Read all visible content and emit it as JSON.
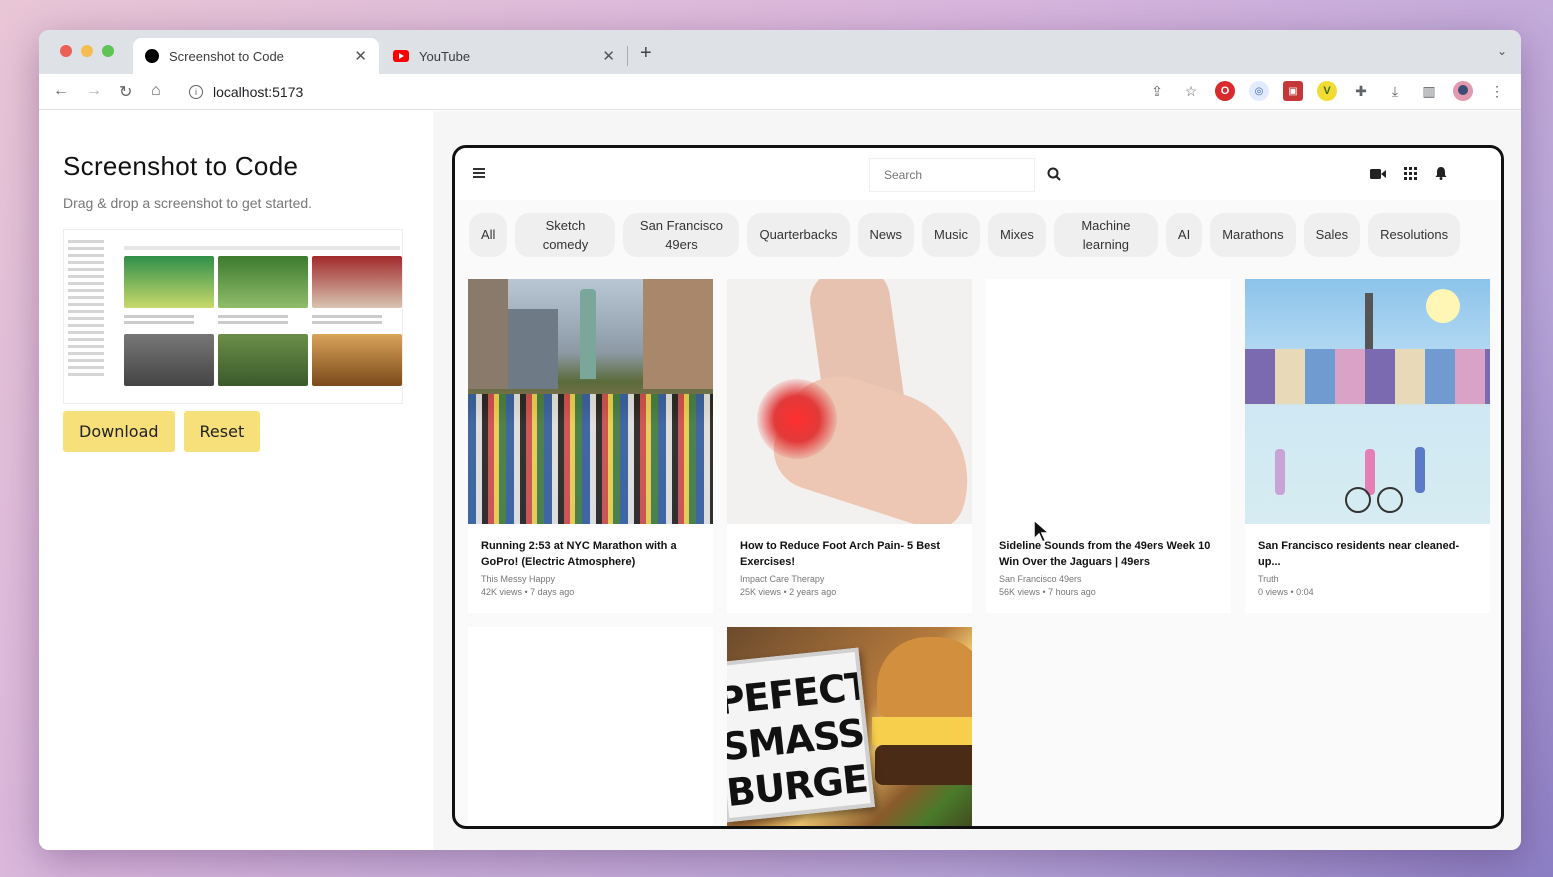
{
  "browser": {
    "tabs": [
      {
        "title": "Screenshot to Code",
        "active": true
      },
      {
        "title": "YouTube",
        "active": false
      }
    ],
    "new_tab": "+",
    "url": "localhost:5173"
  },
  "app": {
    "title": "Screenshot to Code",
    "subtitle": "Drag & drop a screenshot to get started.",
    "download_label": "Download",
    "reset_label": "Reset",
    "accent_color": "#f7e07a"
  },
  "preview": {
    "search_placeholder": "Search",
    "chips": [
      "All",
      "Sketch comedy",
      "San Francisco 49ers",
      "Quarterbacks",
      "News",
      "Music",
      "Mixes",
      "Machine learning",
      "AI",
      "Marathons",
      "Sales",
      "Resolutions"
    ],
    "videos": [
      {
        "title": "Running 2:53 at NYC Marathon with a GoPro! (Electric Atmosphere)",
        "channel": "This Messy Happy",
        "meta": "42K views • 7 days ago"
      },
      {
        "title": "How to Reduce Foot Arch Pain- 5 Best Exercises!",
        "channel": "Impact Care Therapy",
        "meta": "25K views • 2 years ago"
      },
      {
        "title": "Sideline Sounds from the 49ers Week 10 Win Over the Jaguars | 49ers",
        "channel": "San Francisco 49ers",
        "meta": "56K views • 7 hours ago"
      },
      {
        "title": "San Francisco residents near cleaned-up...",
        "channel": "Truth",
        "meta": "0 views • 0:04"
      }
    ],
    "burger_sign": [
      "PEFECT",
      "SMASSH",
      "BURGER"
    ]
  }
}
